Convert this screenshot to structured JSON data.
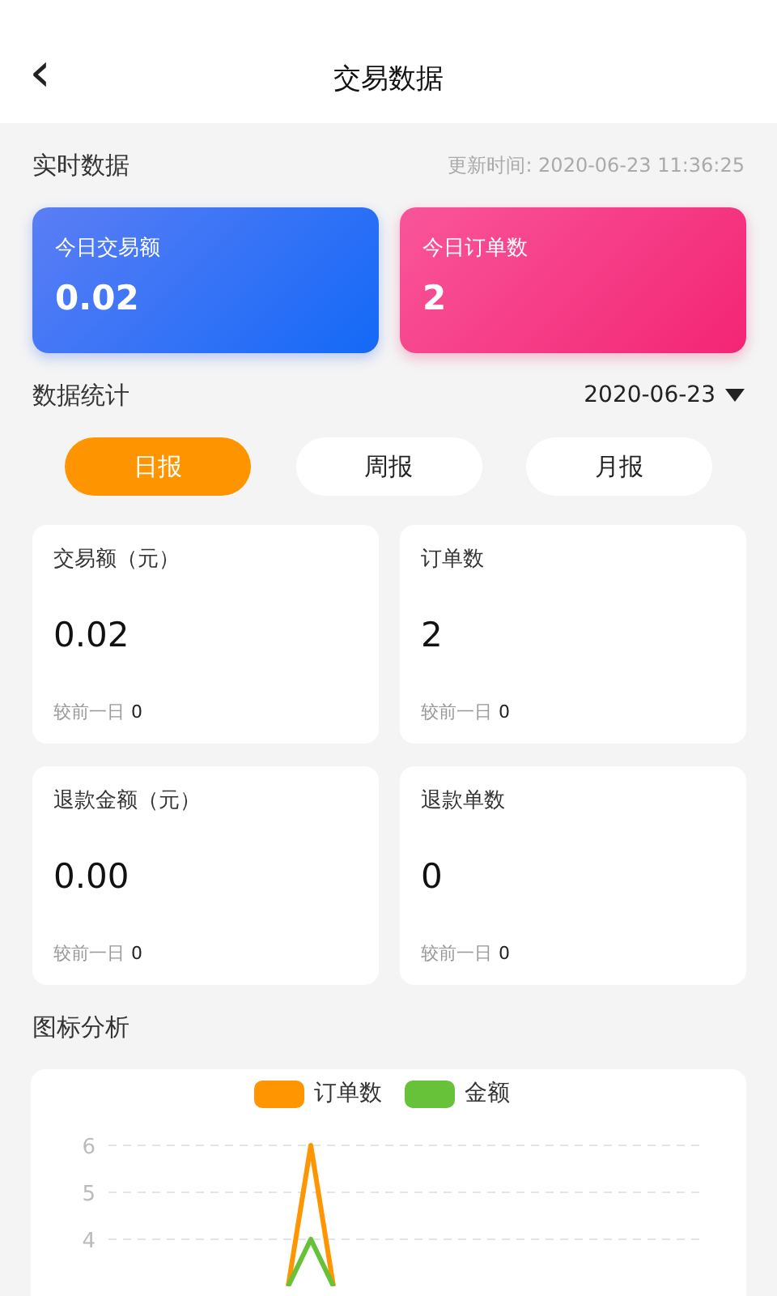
{
  "header": {
    "back_icon": "‹",
    "title": "交易数据"
  },
  "realtime": {
    "title": "实时数据",
    "updated": "更新时间: 2020-06-23 11:36:25",
    "cards": [
      {
        "kind": "blue",
        "label": "今日交易额",
        "value": "0.02"
      },
      {
        "kind": "pink",
        "label": "今日订单数",
        "value": "2"
      }
    ]
  },
  "stats": {
    "title": "数据统计",
    "date": "2020-06-23",
    "tabs": [
      {
        "label": "日报",
        "selected": true
      },
      {
        "label": "周报",
        "selected": false
      },
      {
        "label": "月报",
        "selected": false
      }
    ],
    "cards": [
      {
        "label": "交易额（元）",
        "value": "0.02",
        "compare_label": "较前一日",
        "compare_value": "0"
      },
      {
        "label": "订单数",
        "value": "2",
        "compare_label": "较前一日",
        "compare_value": "0"
      },
      {
        "label": "退款金额（元）",
        "value": "0.00",
        "compare_label": "较前一日",
        "compare_value": "0"
      },
      {
        "label": "退款单数",
        "value": "0",
        "compare_label": "较前一日",
        "compare_value": "0"
      }
    ]
  },
  "analysis": {
    "title": "图标分析",
    "legend": [
      {
        "name": "订单数",
        "color": "#ff9500"
      },
      {
        "name": "金额",
        "color": "#67c23a"
      }
    ],
    "y_tick_labels": [
      "6",
      "5",
      "4"
    ]
  }
}
